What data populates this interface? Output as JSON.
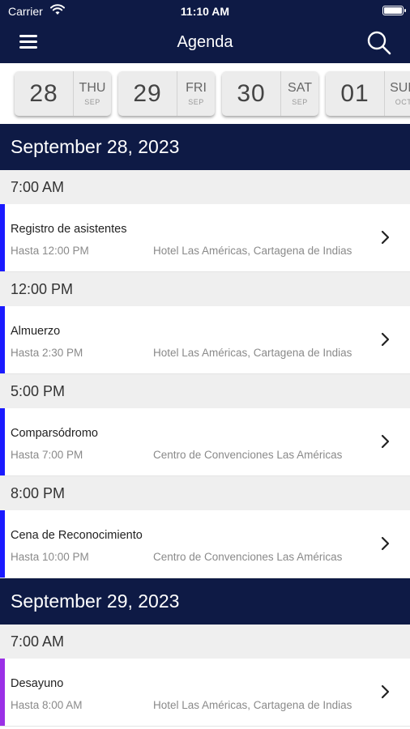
{
  "status_bar": {
    "carrier": "Carrier",
    "time": "11:10 AM"
  },
  "nav": {
    "title": "Agenda"
  },
  "date_strip": [
    {
      "day": "28",
      "dow": "THU",
      "month": "SEP"
    },
    {
      "day": "29",
      "dow": "FRI",
      "month": "SEP"
    },
    {
      "day": "30",
      "dow": "SAT",
      "month": "SEP"
    },
    {
      "day": "01",
      "dow": "SUN",
      "month": "OCT"
    }
  ],
  "days": [
    {
      "date": "September 28, 2023",
      "slots": [
        {
          "time": "7:00 AM",
          "event": {
            "title": "Registro de asistentes",
            "until": "Hasta 12:00 PM",
            "location": "Hotel Las Américas, Cartagena de Indias",
            "accent": "#1a1aff"
          }
        },
        {
          "time": "12:00 PM",
          "event": {
            "title": "Almuerzo",
            "until": "Hasta 2:30 PM",
            "location": "Hotel Las Américas, Cartagena de Indias",
            "accent": "#1a1aff"
          }
        },
        {
          "time": "5:00 PM",
          "event": {
            "title": "Comparsódromo",
            "until": "Hasta 7:00 PM",
            "location": "Centro de Convenciones Las Américas",
            "accent": "#1a1aff"
          }
        },
        {
          "time": "8:00 PM",
          "event": {
            "title": "Cena de Reconocimiento",
            "until": "Hasta 10:00 PM",
            "location": "Centro de Convenciones Las Américas",
            "accent": "#1a1aff"
          }
        }
      ]
    },
    {
      "date": "September 29, 2023",
      "slots": [
        {
          "time": "7:00 AM",
          "event": {
            "title": "Desayuno",
            "until": "Hasta 8:00 AM",
            "location": "Hotel Las Américas, Cartagena de Indias",
            "accent": "#9b30e6"
          }
        }
      ]
    }
  ],
  "colors": {
    "header_bg": "#0e1a45",
    "time_header_bg": "#efefef",
    "date_card_bg": "#ececec"
  },
  "icons": {
    "menu": "hamburger-icon",
    "search": "search-icon",
    "chevron": "chevron-right-icon",
    "wifi": "wifi-icon",
    "battery": "battery-icon"
  }
}
